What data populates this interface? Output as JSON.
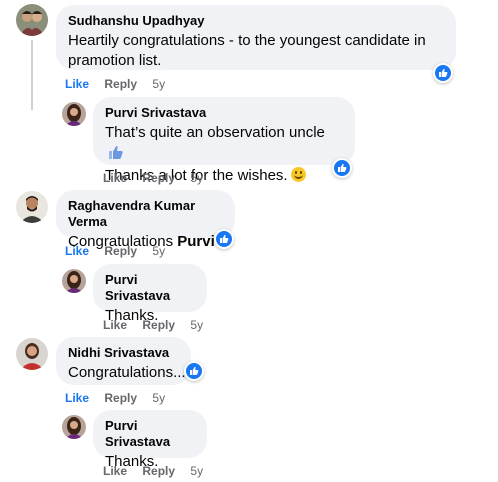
{
  "comments": [
    {
      "author": "Sudhanshu Upadhyay",
      "text_line1": "Heartily congratulations - to the youngest candidate in",
      "text_line2": "pramotion list.",
      "like": "Like",
      "reply": "Reply",
      "age": "5y",
      "reaction": "like-icon"
    },
    {
      "author": "Purvi Srivastava",
      "text_line1": "That’s quite an observation uncle",
      "text_line2": "Thanks a lot for the wishes.",
      "like": "Like",
      "reply": "Reply",
      "age": "5y",
      "reaction": "like-icon"
    },
    {
      "author": "Raghavendra Kumar Verma",
      "text_prefix": "Congratulations",
      "text_bold": "Purvi",
      "like": "Like",
      "reply": "Reply",
      "age": "5y",
      "reaction": "like-icon"
    },
    {
      "author": "Purvi Srivastava",
      "text": "Thanks.",
      "like": "Like",
      "reply": "Reply",
      "age": "5y"
    },
    {
      "author": "Nidhi Srivastava",
      "text": "Congratulations...",
      "like": "Like",
      "reply": "Reply",
      "age": "5y",
      "reaction": "like-icon"
    },
    {
      "author": "Purvi Srivastava",
      "text": "Thanks.",
      "like": "Like",
      "reply": "Reply",
      "age": "5y"
    }
  ],
  "colors": {
    "bubble": "#f0f2f5",
    "like_active": "#1877f2",
    "meta": "#65676b",
    "reaction_blue": "#1877f2"
  }
}
